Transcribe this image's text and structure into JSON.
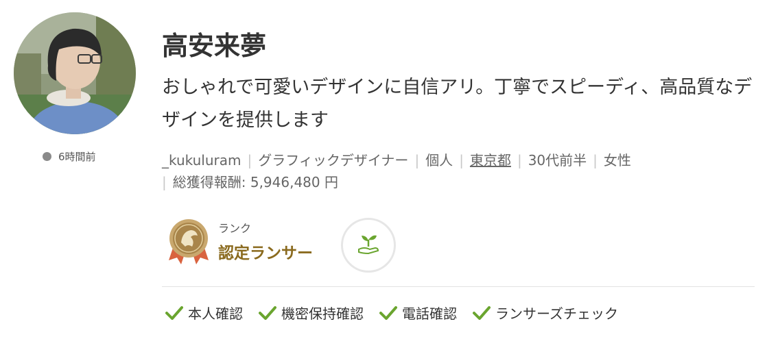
{
  "profile": {
    "name": "高安来夢",
    "catchphrase": "おしゃれで可愛いデザインに自信アリ。丁寧でスピーディ、高品質なデザインを提供します",
    "status": "6時間前",
    "avatar_icon": "user-photo"
  },
  "meta": {
    "username": "_kukuluram",
    "occupation": "グラフィックデザイナー",
    "type": "個人",
    "location": "東京都",
    "age": "30代前半",
    "gender": "女性",
    "earnings_label": "総獲得報酬: 5,946,480 円"
  },
  "rank": {
    "label": "ランク",
    "value": "認定ランサー",
    "medal_icon": "certified-medal-icon",
    "sub_badge_icon": "sprout-hand-icon"
  },
  "verifications": [
    {
      "label": "本人確認",
      "icon": "check-icon"
    },
    {
      "label": "機密保持確認",
      "icon": "check-icon"
    },
    {
      "label": "電話確認",
      "icon": "check-icon"
    },
    {
      "label": "ランサーズチェック",
      "icon": "check-icon"
    }
  ],
  "colors": {
    "check": "#6aa52f",
    "rank_text": "#8a6a1e",
    "medal": "#b08d57",
    "ribbon": "#d9633f",
    "status_dot": "#8a8a8a"
  }
}
